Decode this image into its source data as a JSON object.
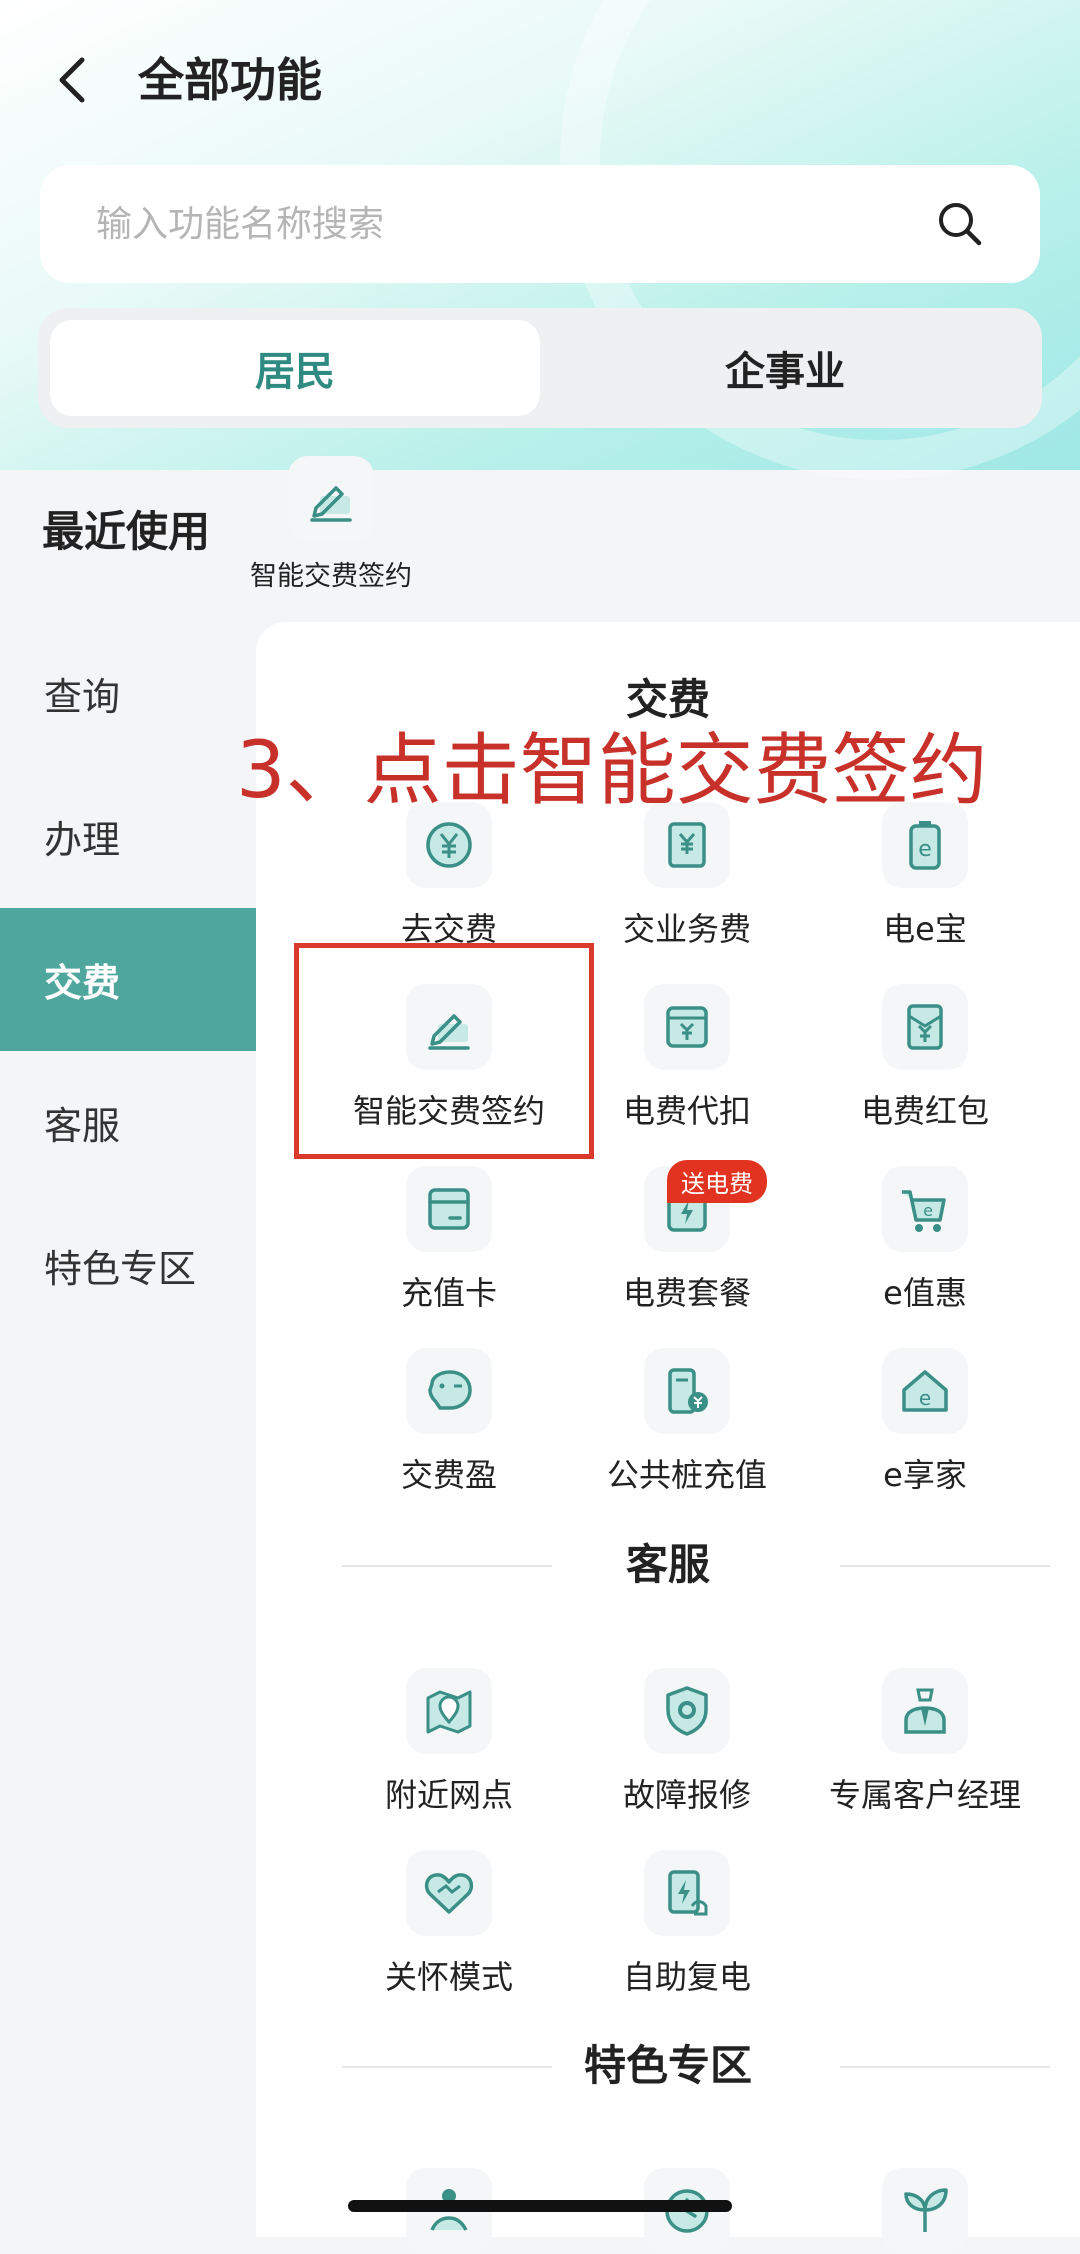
{
  "header": {
    "title": "全部功能"
  },
  "search": {
    "placeholder": "输入功能名称搜索"
  },
  "segments": [
    {
      "label": "居民",
      "active": true
    },
    {
      "label": "企事业",
      "active": false
    }
  ],
  "recent": {
    "label": "最近使用",
    "items": [
      {
        "label": "智能交费签约",
        "icon": "pen-sign-icon"
      }
    ]
  },
  "sidebar": {
    "items": [
      "查询",
      "办理",
      "交费",
      "客服",
      "特色专区"
    ],
    "active_index": 2
  },
  "sections": [
    {
      "title": "交费",
      "items": [
        {
          "label": "去交费",
          "icon": "yuan-circle-icon"
        },
        {
          "label": "交业务费",
          "icon": "yuan-doc-icon"
        },
        {
          "label": "电e宝",
          "icon": "e-battery-icon"
        },
        {
          "label": "智能交费签约",
          "icon": "pen-sign-icon"
        },
        {
          "label": "电费代扣",
          "icon": "yuan-card-icon"
        },
        {
          "label": "电费红包",
          "icon": "envelope-icon"
        },
        {
          "label": "充值卡",
          "icon": "card-icon"
        },
        {
          "label": "电费套餐",
          "icon": "lightning-box-icon"
        },
        {
          "label": "e值惠",
          "icon": "e-cart-icon"
        },
        {
          "label": "交费盈",
          "icon": "piggy-bank-icon"
        },
        {
          "label": "公共桩充值",
          "icon": "charging-pile-icon"
        },
        {
          "label": "e享家",
          "icon": "e-home-icon"
        }
      ]
    },
    {
      "title": "客服",
      "items": [
        {
          "label": "附近网点",
          "icon": "map-pin-icon"
        },
        {
          "label": "故障报修",
          "icon": "shield-gear-icon"
        },
        {
          "label": "专属客户经理",
          "icon": "manager-icon"
        },
        {
          "label": "关怀模式",
          "icon": "heart-hands-icon"
        },
        {
          "label": "自助复电",
          "icon": "power-hand-icon"
        }
      ]
    },
    {
      "title": "特色专区",
      "items": []
    }
  ],
  "badge": {
    "text": "送电费"
  },
  "annotation": {
    "text": "3、点击智能交费签约"
  },
  "colors": {
    "accent": "#4fa69c",
    "accent_text": "#2f8a82",
    "badge": "#e1331f",
    "annotation": "#c8312a"
  }
}
